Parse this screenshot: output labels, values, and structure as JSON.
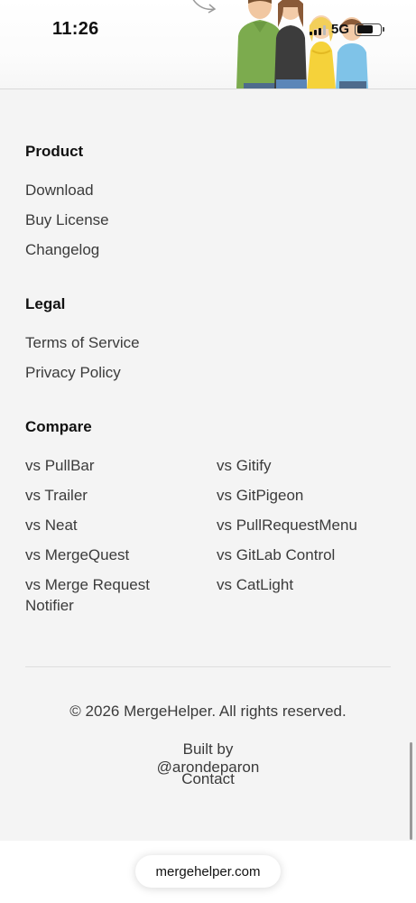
{
  "status_bar": {
    "time": "11:26",
    "network": "5G",
    "signal_bars_active": 3,
    "battery_level": 0.7
  },
  "hero": {
    "illustration": "cartoon-family-image",
    "arrow": "curved-arrow-icon"
  },
  "footer": {
    "product": {
      "title": "Product",
      "links": [
        "Download",
        "Buy License",
        "Changelog"
      ]
    },
    "legal": {
      "title": "Legal",
      "links": [
        "Terms of Service",
        "Privacy Policy"
      ]
    },
    "compare": {
      "title": "Compare",
      "left": [
        "vs PullBar",
        "vs Trailer",
        "vs Neat",
        "vs MergeQuest",
        "vs Merge Request Notifier"
      ],
      "right": [
        "vs Gitify",
        "vs GitPigeon",
        "vs PullRequestMenu",
        "vs GitLab Control",
        "vs CatLight"
      ]
    },
    "copyright": "© 2026 MergeHelper. All rights reserved.",
    "built_by": "Built by @arondeparon",
    "contact": "Contact"
  },
  "browser": {
    "url": "mergehelper.com"
  },
  "colors": {
    "background": "#f4f4f4",
    "text": "#3b3b3b",
    "heading": "#111111"
  }
}
